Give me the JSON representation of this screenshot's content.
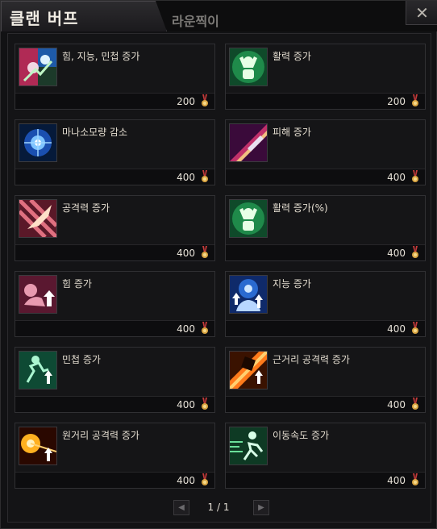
{
  "tabs": [
    {
      "label": "클랜 버프",
      "active": true
    },
    {
      "label": "라운찍이",
      "active": false
    }
  ],
  "close_label": "✕",
  "currency_icon": "medal-icon",
  "buffs": [
    {
      "name": "힘, 지능, 민첩 증가",
      "price": "200",
      "icon": "stats-icon"
    },
    {
      "name": "활력 증가",
      "price": "200",
      "icon": "vitality-icon"
    },
    {
      "name": "마나소모량 감소",
      "price": "400",
      "icon": "mana-orb-icon"
    },
    {
      "name": "피해 증가",
      "price": "400",
      "icon": "blade-icon"
    },
    {
      "name": "공격력 증가",
      "price": "400",
      "icon": "attack-icon"
    },
    {
      "name": "활력 증가(%)",
      "price": "400",
      "icon": "vitality-percent-icon"
    },
    {
      "name": "힘 증가",
      "price": "400",
      "icon": "strength-icon"
    },
    {
      "name": "지능 증가",
      "price": "400",
      "icon": "intelligence-icon"
    },
    {
      "name": "민첩 증가",
      "price": "400",
      "icon": "agility-icon"
    },
    {
      "name": "근거리 공격력 증가",
      "price": "400",
      "icon": "melee-icon"
    },
    {
      "name": "원거리 공격력 증가",
      "price": "400",
      "icon": "ranged-icon"
    },
    {
      "name": "이동속도 증가",
      "price": "400",
      "icon": "speed-icon"
    }
  ],
  "pagination": {
    "text": "1 / 1",
    "prev": "◀",
    "next": "▶"
  }
}
